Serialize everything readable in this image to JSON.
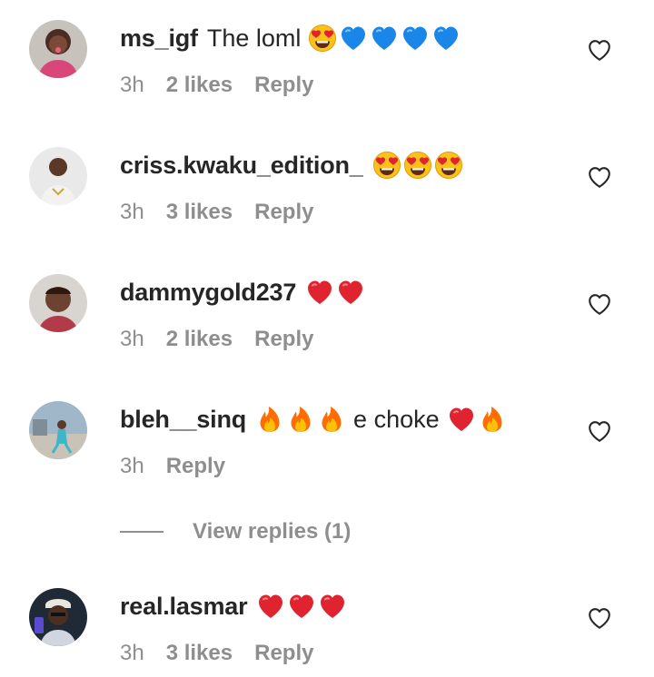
{
  "comments": [
    {
      "username": "ms_igf",
      "text": "The loml",
      "emojis": [
        "heart-eyes",
        "blue-heart",
        "blue-heart",
        "blue-heart",
        "blue-heart"
      ],
      "time": "3h",
      "likes": "2 likes",
      "reply": "Reply"
    },
    {
      "username": "criss.kwaku_edition_",
      "text": "",
      "emojis": [
        "heart-eyes",
        "heart-eyes",
        "heart-eyes"
      ],
      "time": "3h",
      "likes": "3 likes",
      "reply": "Reply"
    },
    {
      "username": "dammygold237",
      "text": "",
      "emojis": [
        "red-heart",
        "red-heart"
      ],
      "time": "3h",
      "likes": "2 likes",
      "reply": "Reply"
    },
    {
      "username": "bleh__sinq",
      "text": "e choke",
      "emojis_before": [
        "fire",
        "fire",
        "fire"
      ],
      "emojis_after": [
        "red-heart",
        "fire"
      ],
      "time": "3h",
      "likes": "",
      "reply": "Reply"
    },
    {
      "username": "real.lasmar",
      "text": "",
      "emojis": [
        "red-heart",
        "red-heart",
        "red-heart"
      ],
      "time": "3h",
      "likes": "3 likes",
      "reply": "Reply"
    }
  ],
  "view_replies": {
    "label": "View replies (1)"
  },
  "colors": {
    "text": "#262626",
    "meta": "#8e8e8e",
    "red_heart": "#e0242f",
    "blue_heart": "#1a86e8",
    "fire": "#ff8a00"
  }
}
